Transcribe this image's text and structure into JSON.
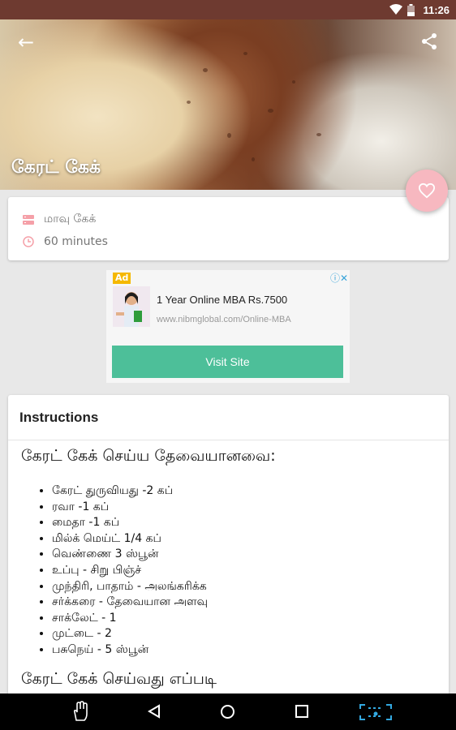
{
  "status_bar": {
    "time": "11:26"
  },
  "hero": {
    "title": "கேரட் கேக்"
  },
  "meta": {
    "category": "மாவு கேக்",
    "duration": "60 minutes"
  },
  "ad": {
    "badge": "Ad",
    "headline": "1 Year Online MBA Rs.7500",
    "url": "www.nibmglobal.com/Online-MBA",
    "button": "Visit Site"
  },
  "instructions": {
    "header": "Instructions",
    "ingredients_title": "கேரட் கேக் செய்ய தேவையானவை:",
    "ingredients": [
      "கேரட் துருவியது -2 கப்",
      "ரவா -1 கப்",
      "மைதா -1 கப்",
      "மில்க் மெய்ட் 1/4 கப்",
      "வெண்ணை 3 ஸ்பூன்",
      "உப்பு - சிறு பிஞ்ச்",
      "முந்திரி, பாதாம் - அலங்கரிக்க",
      "சர்க்கரை - தேவையான அளவு",
      "சாக்லேட் - 1",
      "முட்டை - 2",
      "பசுநெய் - 5 ஸ்பூன்"
    ],
    "method_title": "கேரட் கேக் செய்வது எப்படி"
  },
  "colors": {
    "status_bar": "#6e3a30",
    "fab": "#f7b8c0",
    "accent_icon": "#f5a0a8",
    "ad_button": "#4dbf99"
  }
}
